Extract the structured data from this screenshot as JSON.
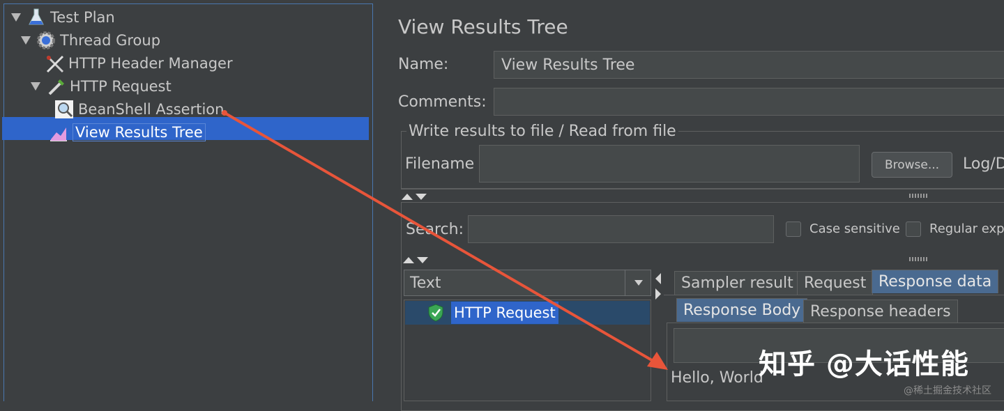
{
  "tree": {
    "items": [
      {
        "label": "Test Plan",
        "icon": "flask-icon"
      },
      {
        "label": "Thread Group",
        "icon": "gear-icon"
      },
      {
        "label": "HTTP Header Manager",
        "icon": "tools-icon"
      },
      {
        "label": "HTTP Request",
        "icon": "pipette-icon"
      },
      {
        "label": "BeanShell Assertion",
        "icon": "magnifier-icon"
      },
      {
        "label": "View Results Tree",
        "icon": "chart-icon"
      }
    ]
  },
  "panel": {
    "title": "View Results Tree",
    "name_label": "Name:",
    "name_value": "View Results Tree",
    "comments_label": "Comments:",
    "comments_value": "",
    "file_group_title": "Write results to file / Read from file",
    "filename_label": "Filename",
    "filename_value": "",
    "browse_label": "Browse...",
    "log_label": "Log/D",
    "search_label": "Search:",
    "search_value": "",
    "case_sensitive_label": "Case sensitive",
    "regex_label": "Regular exp.",
    "renderer_selected": "Text",
    "result_item": "HTTP Request"
  },
  "tabs": {
    "top": [
      "Sampler result",
      "Request",
      "Response data"
    ],
    "sub": [
      "Response Body",
      "Response headers"
    ]
  },
  "response": {
    "body": "Hello, World"
  },
  "watermark": {
    "main": "知乎 @大话性能",
    "sub": "@稀土掘金技术社区"
  },
  "colors": {
    "background": "#3c3f41",
    "selection": "#2f65ca",
    "annotation_arrow": "#e8553a",
    "success_shield": "#3aa655"
  }
}
